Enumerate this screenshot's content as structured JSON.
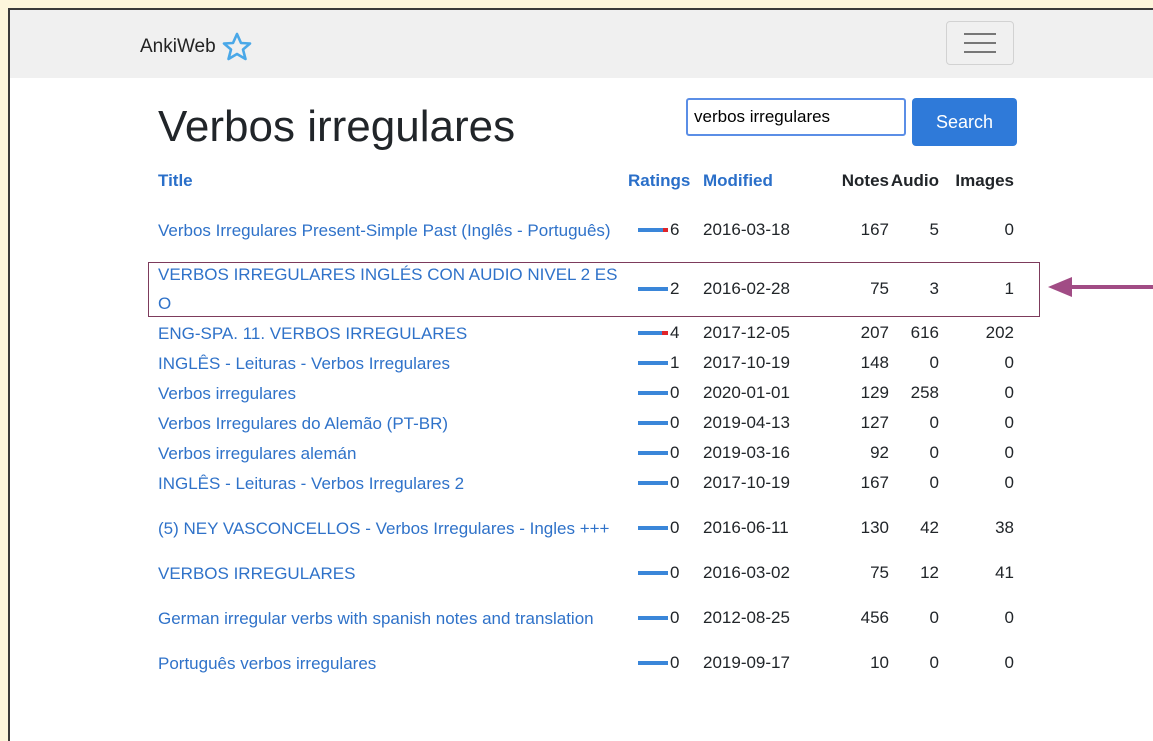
{
  "navbar": {
    "brand": "AnkiWeb"
  },
  "page": {
    "title": "Verbos irregulares"
  },
  "search": {
    "value": "verbos irregulares",
    "button_label": "Search"
  },
  "table": {
    "headers": {
      "title": "Title",
      "ratings": "Ratings",
      "modified": "Modified",
      "notes": "Notes",
      "audio": "Audio",
      "images": "Images"
    },
    "rows": [
      {
        "title": "Verbos Irregulares Present-Simple Past (Inglês - Português)",
        "rating": "6",
        "rating_negative": 0.15,
        "modified": "2016-03-18",
        "notes": "167",
        "audio": "5",
        "images": "0"
      },
      {
        "title": "VERBOS IRREGULARES INGLÉS CON AUDIO NIVEL 2 ESO",
        "rating": "2",
        "rating_negative": 0,
        "modified": "2016-02-28",
        "notes": "75",
        "audio": "3",
        "images": "1"
      },
      {
        "title": "ENG-SPA. 11. VERBOS IRREGULARES",
        "rating": "4",
        "rating_negative": 0.2,
        "modified": "2017-12-05",
        "notes": "207",
        "audio": "616",
        "images": "202"
      },
      {
        "title": "INGLÊS - Leituras - Verbos Irregulares",
        "rating": "1",
        "rating_negative": 0,
        "modified": "2017-10-19",
        "notes": "148",
        "audio": "0",
        "images": "0"
      },
      {
        "title": "Verbos irregulares",
        "rating": "0",
        "rating_negative": 0,
        "modified": "2020-01-01",
        "notes": "129",
        "audio": "258",
        "images": "0"
      },
      {
        "title": "Verbos Irregulares do Alemão (PT-BR)",
        "rating": "0",
        "rating_negative": 0,
        "modified": "2019-04-13",
        "notes": "127",
        "audio": "0",
        "images": "0"
      },
      {
        "title": "Verbos irregulares alemán",
        "rating": "0",
        "rating_negative": 0,
        "modified": "2019-03-16",
        "notes": "92",
        "audio": "0",
        "images": "0"
      },
      {
        "title": "INGLÊS - Leituras - Verbos Irregulares 2",
        "rating": "0",
        "rating_negative": 0,
        "modified": "2017-10-19",
        "notes": "167",
        "audio": "0",
        "images": "0"
      },
      {
        "title": "(5) NEY VASCONCELLOS - Verbos Irregulares - Ingles +++",
        "rating": "0",
        "rating_negative": 0,
        "modified": "2016-06-11",
        "notes": "130",
        "audio": "42",
        "images": "38"
      },
      {
        "title": "VERBOS IRREGULARES",
        "rating": "0",
        "rating_negative": 0,
        "modified": "2016-03-02",
        "notes": "75",
        "audio": "12",
        "images": "41"
      },
      {
        "title": "German irregular verbs with spanish notes and translation",
        "rating": "0",
        "rating_negative": 0,
        "modified": "2012-08-25",
        "notes": "456",
        "audio": "0",
        "images": "0"
      },
      {
        "title": "Português verbos irregulares",
        "rating": "0",
        "rating_negative": 0,
        "modified": "2019-09-17",
        "notes": "10",
        "audio": "0",
        "images": "0"
      }
    ]
  },
  "colors": {
    "link": "#2f72c9",
    "rating_bar": "#3a86d9",
    "rating_bar_negative": "#e0242a",
    "highlight_box": "#7d3b5c",
    "arrow": "#a14c85",
    "muted_zero": "#d4d4d4"
  },
  "icons": {
    "brand": "star-outline-icon",
    "menu": "hamburger-menu-icon",
    "annotation": "arrow-left-icon"
  }
}
